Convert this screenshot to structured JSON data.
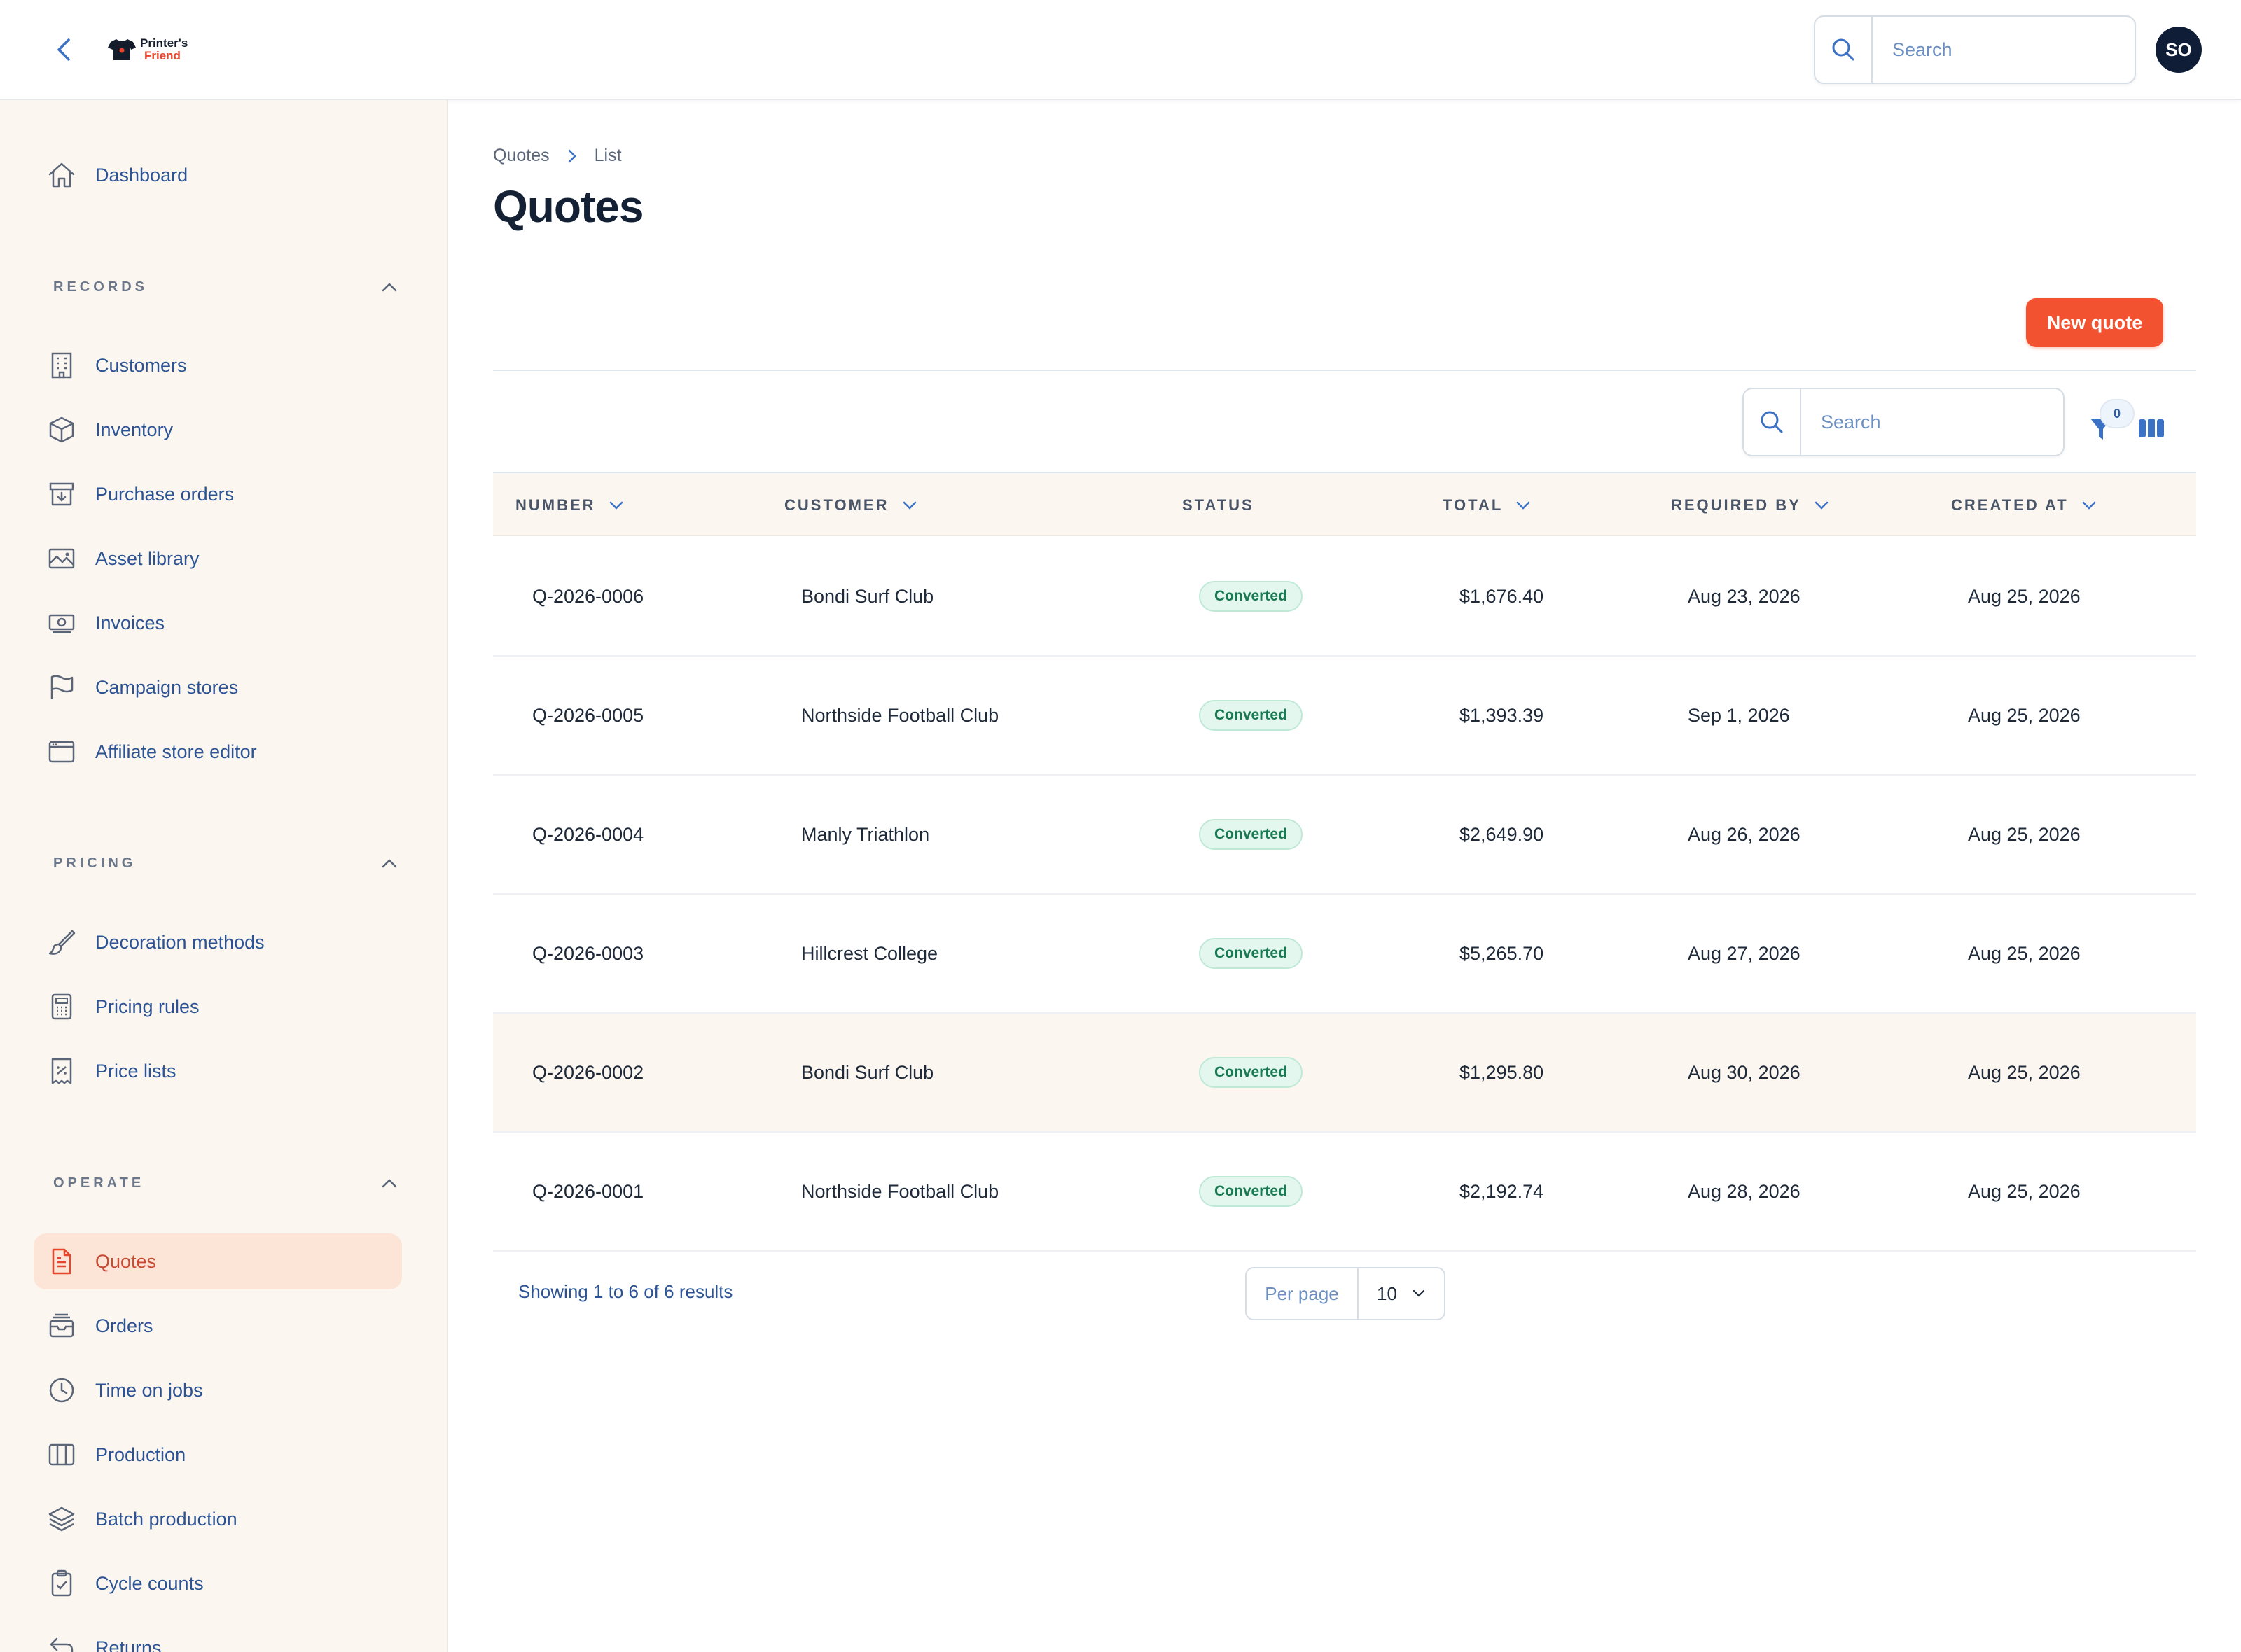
{
  "app": {
    "logo_line1": "Printer's",
    "logo_line2": "Friend",
    "search_placeholder": "Search",
    "avatar_initials": "SO"
  },
  "sidebar": {
    "dashboard": "Dashboard",
    "sections": {
      "records": "RECORDS",
      "pricing": "PRICING",
      "operate": "OPERATE"
    },
    "records_items": [
      "Customers",
      "Inventory",
      "Purchase orders",
      "Asset library",
      "Invoices",
      "Campaign stores",
      "Affiliate store editor"
    ],
    "pricing_items": [
      "Decoration methods",
      "Pricing rules",
      "Price lists"
    ],
    "operate_items": [
      "Quotes",
      "Orders",
      "Time on jobs",
      "Production",
      "Batch production",
      "Cycle counts",
      "Returns"
    ],
    "active_item": "Quotes"
  },
  "page": {
    "breadcrumb": [
      "Quotes",
      "List"
    ],
    "title": "Quotes",
    "new_button": "New quote"
  },
  "table": {
    "search_placeholder": "Search",
    "filter_count": "0",
    "columns": [
      "NUMBER",
      "CUSTOMER",
      "STATUS",
      "TOTAL",
      "REQUIRED BY",
      "CREATED AT"
    ],
    "rows": [
      {
        "number": "Q-2026-0006",
        "customer": "Bondi Surf Club",
        "status": "Converted",
        "total": "$1,676.40",
        "required_by": "Aug 23, 2026",
        "created_at": "Aug 25, 2026"
      },
      {
        "number": "Q-2026-0005",
        "customer": "Northside Football Club",
        "status": "Converted",
        "total": "$1,393.39",
        "required_by": "Sep 1, 2026",
        "created_at": "Aug 25, 2026"
      },
      {
        "number": "Q-2026-0004",
        "customer": "Manly Triathlon",
        "status": "Converted",
        "total": "$2,649.90",
        "required_by": "Aug 26, 2026",
        "created_at": "Aug 25, 2026"
      },
      {
        "number": "Q-2026-0003",
        "customer": "Hillcrest College",
        "status": "Converted",
        "total": "$5,265.70",
        "required_by": "Aug 27, 2026",
        "created_at": "Aug 25, 2026"
      },
      {
        "number": "Q-2026-0002",
        "customer": "Bondi Surf Club",
        "status": "Converted",
        "total": "$1,295.80",
        "required_by": "Aug 30, 2026",
        "created_at": "Aug 25, 2026"
      },
      {
        "number": "Q-2026-0001",
        "customer": "Northside Football Club",
        "status": "Converted",
        "total": "$2,192.74",
        "required_by": "Aug 28, 2026",
        "created_at": "Aug 25, 2026"
      }
    ],
    "showing_text": "Showing 1 to 6 of 6 results",
    "per_page_label": "Per page",
    "per_page_value": "10"
  },
  "colors": {
    "accent": "#f2522f",
    "sidebar_bg": "#fcf6f0",
    "link": "#2c5494",
    "active_bg": "#fce5d7"
  }
}
